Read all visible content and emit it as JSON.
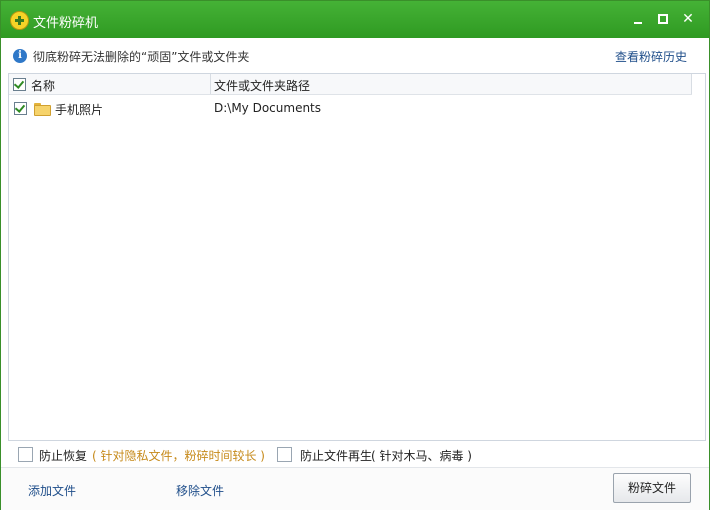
{
  "window": {
    "title": "文件粉碎机"
  },
  "infobar": {
    "message": "彻底粉碎无法删除的“顽固”文件或文件夹",
    "history_link": "查看粉碎历史"
  },
  "list": {
    "columns": [
      "名称",
      "文件或文件夹路径"
    ],
    "header_checked": true,
    "rows": [
      {
        "name": "手机照片",
        "path": "D:\\My Documents",
        "checked": true,
        "icon": "folder-icon"
      }
    ]
  },
  "options": {
    "prevent_recovery": {
      "label": "防止恢复",
      "hint": "( 针对隐私文件，粉碎时间较长 )",
      "checked": false,
      "hint_color": "#c68a1a"
    },
    "prevent_regeneration": {
      "label": "防止文件再生",
      "hint": "( 针对木马、病毒 )",
      "checked": false
    }
  },
  "footer": {
    "add_label": "添加文件",
    "remove_label": "移除文件",
    "shred_label": "粉碎文件"
  },
  "colors": {
    "titlebar": "#3aa82c",
    "link": "#1f4e8a",
    "hint": "#c68a1a"
  }
}
